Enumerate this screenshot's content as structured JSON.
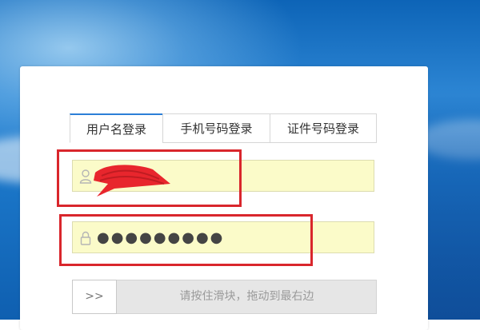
{
  "login": {
    "tabs": [
      {
        "label": "用户名登录",
        "active": true
      },
      {
        "label": "手机号码登录",
        "active": false
      },
      {
        "label": "证件号码登录",
        "active": false
      }
    ],
    "username": {
      "value": "",
      "icon": "user-icon"
    },
    "password": {
      "value": "●●●●●●●●●",
      "icon": "lock-icon"
    },
    "slider": {
      "handle_label": ">>",
      "hint": "请按住滑块，拖动到最右边"
    }
  },
  "colors": {
    "field_bg": "#fbfbc9",
    "highlight": "#d9262c",
    "tab_active": "#2c7fd7",
    "redaction": "#e8262d"
  }
}
